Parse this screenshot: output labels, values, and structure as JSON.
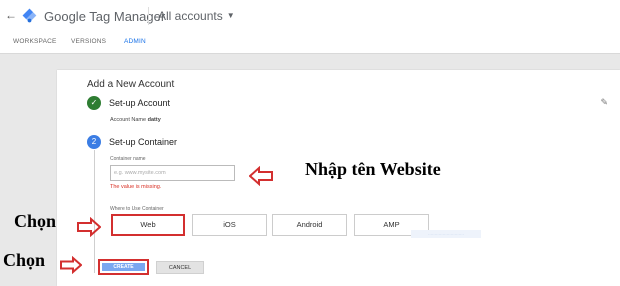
{
  "header": {
    "back_icon": "arrow-left-icon",
    "logo_icon": "tag-manager-logo",
    "app_title": "Google Tag Manager",
    "account_selector": "All accounts",
    "account_caret_icon": "caret-down-icon",
    "caret_glyph": "▼",
    "back_glyph": "←"
  },
  "tabs": [
    {
      "label": "WORKSPACE"
    },
    {
      "label": "VERSIONS"
    },
    {
      "label": "ADMIN"
    }
  ],
  "form": {
    "title": "Add a New Account",
    "edit_icon": "pencil-icon",
    "edit_glyph": "✎",
    "step1": {
      "label": "Set-up Account",
      "status_icon": "check-icon",
      "check_glyph": "✓",
      "account_name_label": "Account Name",
      "account_name_value": "datty"
    },
    "step2": {
      "number": "2",
      "label": "Set-up Container"
    },
    "container_name_label": "Container name",
    "container_name_placeholder": "e.g. www.mysite.com",
    "container_name_value": "",
    "error": "The value is missing.",
    "where_label": "Where to Use Container",
    "options": [
      "Web",
      "iOS",
      "Android",
      "AMP"
    ],
    "selected_option": "Web",
    "faint_text": "………………………",
    "create_label": "CREATE",
    "cancel_label": "CANCEL"
  },
  "annotations": {
    "website_hint": "Nhập tên Website",
    "choose_1": "Chọn",
    "choose_2": "Chọn",
    "arrow_color": "#d32f2f"
  },
  "colors": {
    "accent": "#1a73e8",
    "done": "#2e7d32",
    "step": "#3b7de4",
    "error": "#d93025",
    "highlight": "#d32f2f"
  }
}
